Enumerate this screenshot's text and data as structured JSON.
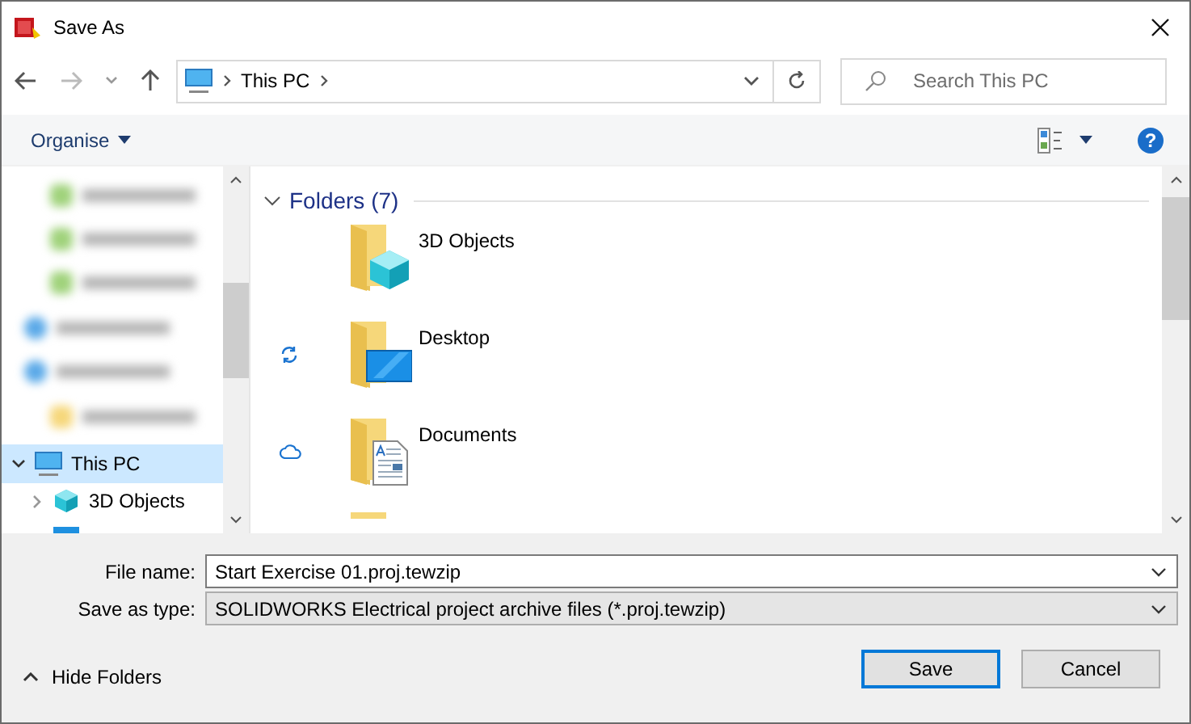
{
  "window": {
    "title": "Save As"
  },
  "address": {
    "path": [
      "This PC"
    ]
  },
  "search": {
    "placeholder": "Search This PC"
  },
  "toolbar": {
    "organise": "Organise",
    "help": "?"
  },
  "nav_tree": [
    {
      "label": "This PC",
      "selected": true,
      "expanded": true,
      "kind": "pc"
    },
    {
      "label": "3D Objects",
      "selected": false,
      "expanded": false,
      "kind": "objects"
    }
  ],
  "group": {
    "label": "Folders (7)",
    "expanded": true
  },
  "folders": [
    {
      "name": "3D Objects",
      "kind": "objects",
      "syncing": false,
      "cloud_only": false
    },
    {
      "name": "Desktop",
      "kind": "desktop",
      "syncing": true,
      "cloud_only": false
    },
    {
      "name": "Documents",
      "kind": "documents",
      "syncing": false,
      "cloud_only": true
    }
  ],
  "file_name": {
    "label": "File name:",
    "value": "Start Exercise 01.proj.tewzip"
  },
  "save_type": {
    "label": "Save as type:",
    "value": "SOLIDWORKS Electrical project archive files (*.proj.tewzip)"
  },
  "hide_folders": "Hide Folders",
  "buttons": [
    {
      "label": "Save",
      "default": true
    },
    {
      "label": "Cancel",
      "default": false
    }
  ]
}
